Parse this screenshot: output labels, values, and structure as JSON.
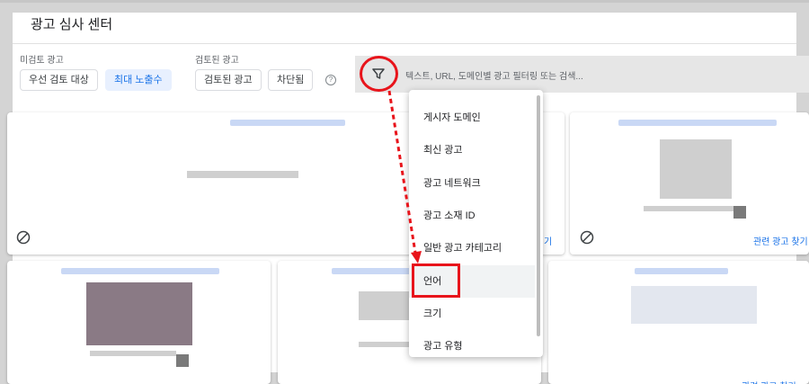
{
  "header": {
    "title": "광고 심사 센터"
  },
  "filters": {
    "group1_label": "미검토 광고",
    "group1_chips": [
      "우선 검토 대상",
      "최대 노출수"
    ],
    "group2_label": "검토된 광고",
    "group2_chips": [
      "검토된 광고",
      "차단됨"
    ],
    "help": "?"
  },
  "search": {
    "placeholder": "텍스트, URL, 도메인별 광고 필터링 또는 검색..."
  },
  "dropdown": {
    "items": [
      "게시자 도메인",
      "최신 광고",
      "광고 네트워크",
      "광고 소재 ID",
      "일반 광고 카테고리",
      "언어",
      "크기",
      "광고 유형"
    ],
    "highlighted": "언어"
  },
  "cards": {
    "related_label": "관련 광고 찾기",
    "related_partial": "기"
  },
  "colors": {
    "annotation": "#e8141b",
    "accent": "#1a73e8"
  }
}
